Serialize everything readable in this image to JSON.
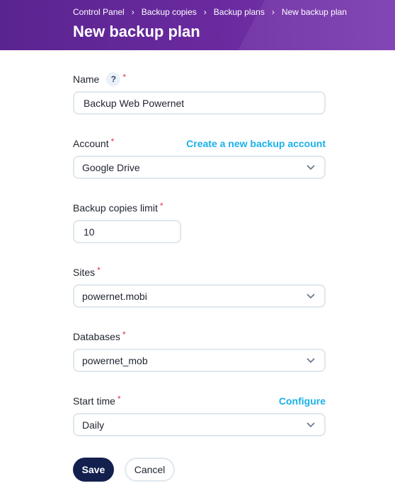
{
  "breadcrumb": {
    "items": [
      "Control Panel",
      "Backup copies",
      "Backup plans",
      "New backup plan"
    ],
    "separator": "›"
  },
  "page_title": "New backup plan",
  "form": {
    "name": {
      "label": "Name",
      "help": "?",
      "value": "Backup Web Powernet"
    },
    "account": {
      "label": "Account",
      "link": "Create a new backup account",
      "value": "Google Drive"
    },
    "backup_limit": {
      "label": "Backup copies limit",
      "value": "10"
    },
    "sites": {
      "label": "Sites",
      "value": "powernet.mobi"
    },
    "databases": {
      "label": "Databases",
      "value": "powernet_mob"
    },
    "start_time": {
      "label": "Start time",
      "link": "Configure",
      "value": "Daily"
    },
    "required_mark": "*"
  },
  "actions": {
    "save": "Save",
    "cancel": "Cancel"
  },
  "colors": {
    "header": "#5a2490",
    "link": "#1ab0e8",
    "required": "#e0334a",
    "primary_button": "#13204e",
    "border": "#dfe8ef"
  },
  "icons": {
    "select_arrow": "chevron-down-icon",
    "help": "help-icon"
  }
}
